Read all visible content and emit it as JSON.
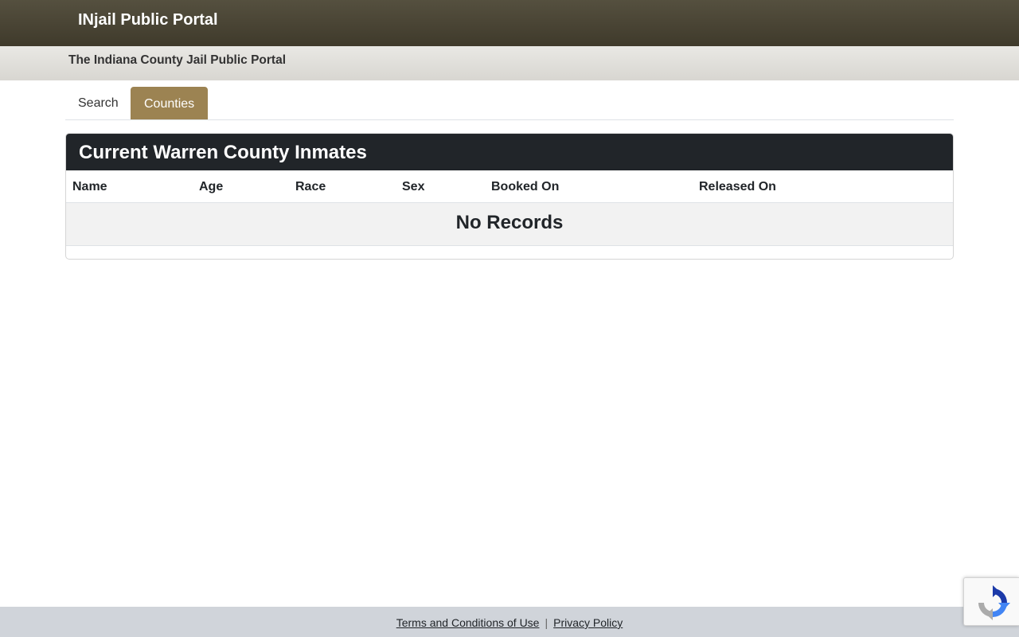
{
  "header": {
    "brand": "INjail Public Portal",
    "subtitle": "The Indiana County Jail Public Portal"
  },
  "tabs": [
    {
      "label": "Search",
      "active": false
    },
    {
      "label": "Counties",
      "active": true
    }
  ],
  "panel": {
    "title": "Current Warren County Inmates",
    "columns": [
      "Name",
      "Age",
      "Race",
      "Sex",
      "Booked On",
      "Released On"
    ],
    "empty_message": "No Records"
  },
  "footer": {
    "terms_label": "Terms and Conditions of Use",
    "separator": "|",
    "privacy_label": "Privacy Policy"
  },
  "colors": {
    "accent": "#9c8352",
    "topbar": "#4a4535",
    "panel_header": "#212529"
  },
  "icons": {
    "recaptcha": "recaptcha-logo-icon"
  }
}
